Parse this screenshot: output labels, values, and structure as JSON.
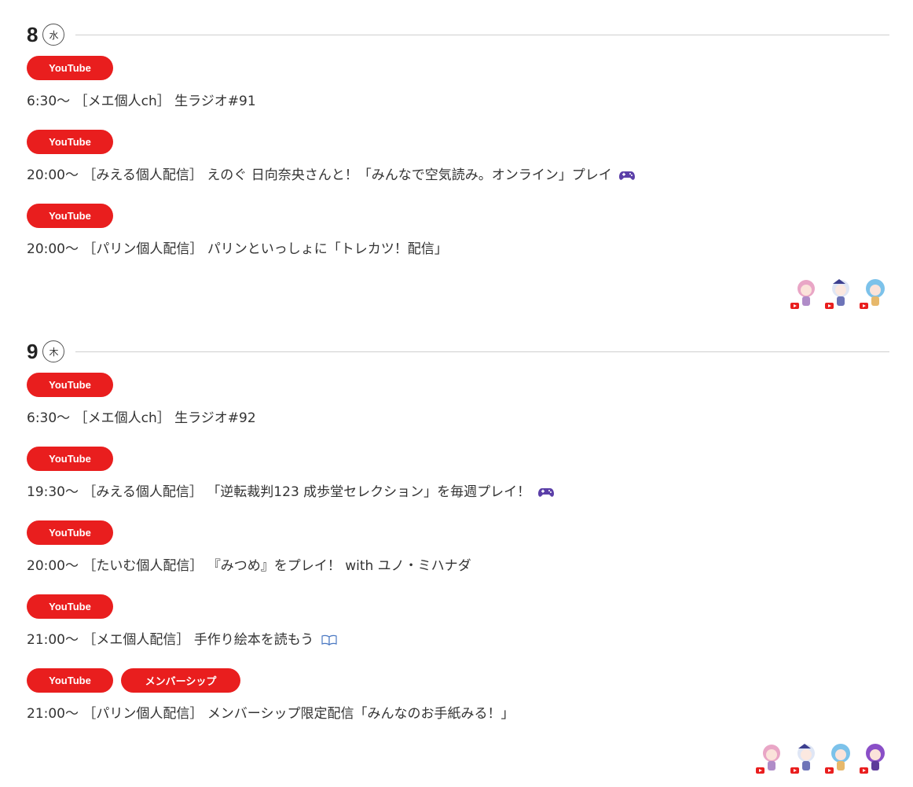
{
  "days": [
    {
      "date": "8",
      "weekday": "水",
      "events": [
        {
          "badges": [
            "YouTube"
          ],
          "time": "6:30〜",
          "channel": "［メエ個人ch］",
          "title": "生ラジオ#91",
          "icon": ""
        },
        {
          "badges": [
            "YouTube"
          ],
          "time": "20:00〜",
          "channel": "［みえる個人配信］",
          "title": "えのぐ 日向奈央さんと！「みんなで空気読み。オンライン」プレイ",
          "icon": "gamepad-icon"
        },
        {
          "badges": [
            "YouTube"
          ],
          "time": "20:00〜",
          "channel": "［パリン個人配信］",
          "title": "パリンといっしょに「トレカツ！配信」",
          "icon": ""
        }
      ],
      "avatars": [
        "pink-hair-character-avatar",
        "white-hair-character-avatar",
        "blue-hair-character-avatar"
      ]
    },
    {
      "date": "9",
      "weekday": "木",
      "events": [
        {
          "badges": [
            "YouTube"
          ],
          "time": "6:30〜",
          "channel": "［メエ個人ch］",
          "title": "生ラジオ#92",
          "icon": ""
        },
        {
          "badges": [
            "YouTube"
          ],
          "time": "19:30〜",
          "channel": "［みえる個人配信］",
          "title": "「逆転裁判123 成歩堂セレクション」を毎週プレイ！",
          "icon": "gamepad-icon"
        },
        {
          "badges": [
            "YouTube"
          ],
          "time": "20:00〜",
          "channel": "［たいむ個人配信］",
          "title": "『みつめ』をプレイ！ with ユノ・ミハナダ",
          "icon": ""
        },
        {
          "badges": [
            "YouTube"
          ],
          "time": "21:00〜",
          "channel": "［メエ個人配信］",
          "title": "手作り絵本を読もう",
          "icon": "book-icon"
        },
        {
          "badges": [
            "YouTube",
            "メンバーシップ"
          ],
          "time": "21:00〜",
          "channel": "［パリン個人配信］",
          "title": "メンバーシップ限定配信「みんなのお手紙みる！」",
          "icon": ""
        }
      ],
      "avatars": [
        "pink-hair-character-avatar",
        "white-hair-character-avatar",
        "blue-hair-character-avatar",
        "purple-hair-character-avatar"
      ]
    }
  ],
  "colors": {
    "badge": "#e91e1e",
    "text": "#333333",
    "rule": "#cfcfcf"
  }
}
